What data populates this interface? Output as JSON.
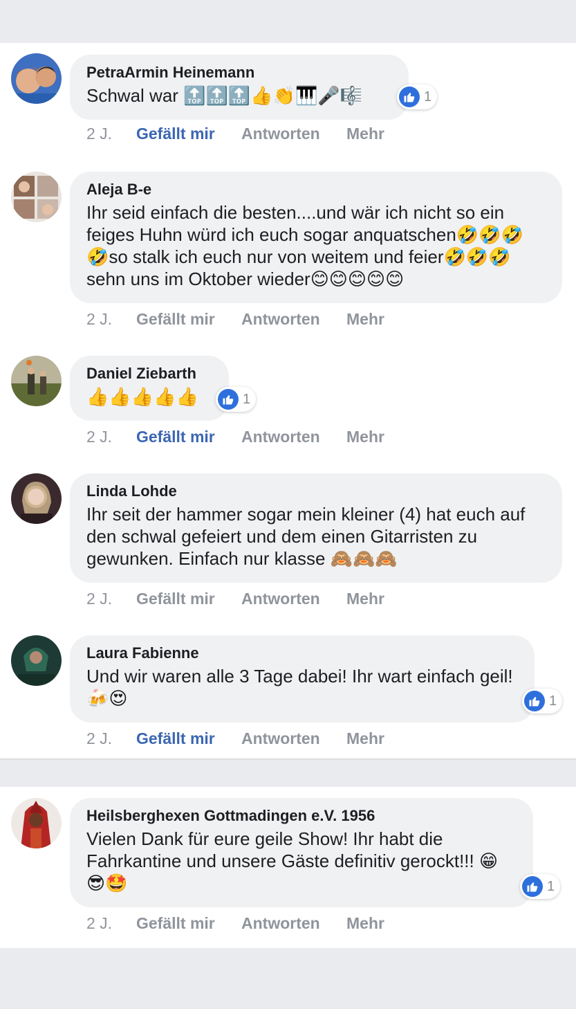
{
  "colors": {
    "page_bg": "#e9ebee",
    "bubble_bg": "#f0f1f3",
    "link_active": "#3b66b3",
    "muted_text": "#90949c",
    "like_blue": "#2e6fdc"
  },
  "actions": {
    "time": "2 J.",
    "like": "Gefällt mir",
    "reply": "Antworten",
    "more": "Mehr"
  },
  "comments": [
    {
      "author": "PetraArmin Heinemann",
      "text": "Schwal war 🔝🔝🔝👍👏🎹🎤🎼",
      "liked": true,
      "reactions": "1",
      "avatar_icon": "couple-photo"
    },
    {
      "author": "Aleja B-e",
      "text": "Ihr seid einfach die besten....und wär ich nicht so ein feiges Huhn würd ich euch sogar anquatschen🤣🤣🤣🤣so stalk ich euch nur von weitem und feier🤣🤣🤣sehn uns im Oktober wieder😊😊😊😊😊",
      "liked": false,
      "reactions": "",
      "avatar_icon": "collage-photo"
    },
    {
      "author": "Daniel Ziebarth",
      "text": "👍👍👍👍👍",
      "liked": true,
      "reactions": "1",
      "avatar_icon": "field-photo"
    },
    {
      "author": "Linda Lohde",
      "text": "Ihr seit der hammer sogar mein kleiner (4) hat euch auf den schwal gefeiert und dem einen Gitarristen zu gewunken. Einfach nur klasse 🙈🙈🙈",
      "liked": false,
      "reactions": "",
      "avatar_icon": "portrait-photo"
    },
    {
      "author": "Laura Fabienne",
      "text": "Und wir waren alle 3 Tage dabei! Ihr wart einfach geil!🍻😍",
      "liked": true,
      "reactions": "1",
      "avatar_icon": "green-photo"
    },
    {
      "author": "Heilsberghexen Gottmadingen e.V. 1956",
      "text": "Vielen Dank für eure geile Show! Ihr habt die Fahrkantine und unsere Gäste definitiv gerockt!!! 😁😎🤩",
      "liked": false,
      "reactions": "1",
      "avatar_icon": "witch-photo"
    }
  ]
}
